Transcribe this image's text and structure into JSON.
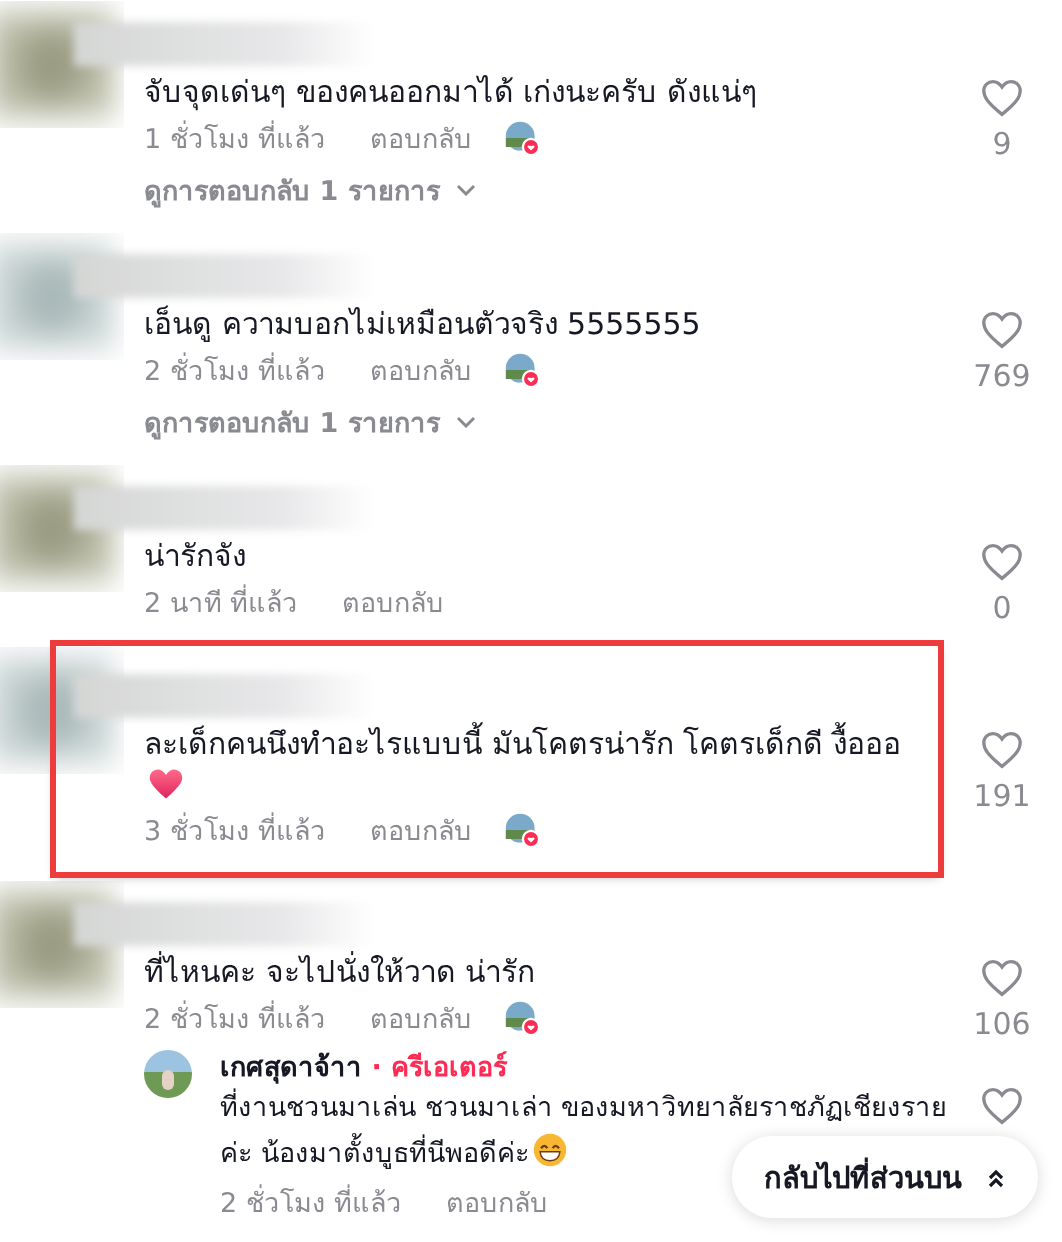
{
  "comments": [
    {
      "text": "จับจุดเด่นๆ ของคนออกมาได้ เก่งนะครับ ดังแน่ๆ",
      "time": "1 ชั่วโมง ที่แล้ว",
      "reply_label": "ตอบกลับ",
      "liked_by_creator": true,
      "likes": "9",
      "view_replies": "ดูการตอบกลับ 1 รายการ",
      "highlighted": false
    },
    {
      "text": "เอ็นดู ความบอกไม่เหมือนตัวจริง 5555555",
      "time": "2 ชั่วโมง ที่แล้ว",
      "reply_label": "ตอบกลับ",
      "liked_by_creator": true,
      "likes": "769",
      "view_replies": "ดูการตอบกลับ 1 รายการ",
      "highlighted": false
    },
    {
      "text": "น่ารักจัง",
      "time": "2 นาที ที่แล้ว",
      "reply_label": "ตอบกลับ",
      "liked_by_creator": false,
      "likes": "0",
      "highlighted": false
    },
    {
      "text": "ละเด็กคนนึงทำอะไรแบบนี้ มันโคตรน่ารัก โคตรเด็กดี งื้อออ",
      "emoji": {
        "kind": "heart"
      },
      "time": "3 ชั่วโมง ที่แล้ว",
      "reply_label": "ตอบกลับ",
      "liked_by_creator": true,
      "likes": "191",
      "highlighted": true
    },
    {
      "text": "ที่ไหนคะ จะไปนั่งให้วาด น่ารัก",
      "time": "2 ชั่วโมง ที่แล้ว",
      "reply_label": "ตอบกลับ",
      "liked_by_creator": true,
      "likes": "106",
      "highlighted": false,
      "reply": {
        "name": "เกศสุดาจ้าา",
        "badge": "· ครีเอเตอร์",
        "text": "ที่งานชวนมาเล่น ชวนมาเล่า ของมหาวิทยาลัยราชภัฏเชียงรายค่ะ น้องมาตั้งบูธที่นีพอดีค่ะ",
        "emoji": {
          "kind": "grin"
        },
        "time": "2 ชั่วโมง ที่แล้ว",
        "reply_label": "ตอบกลับ"
      }
    }
  ],
  "back_to_top": "กลับไปที่ส่วนบน"
}
